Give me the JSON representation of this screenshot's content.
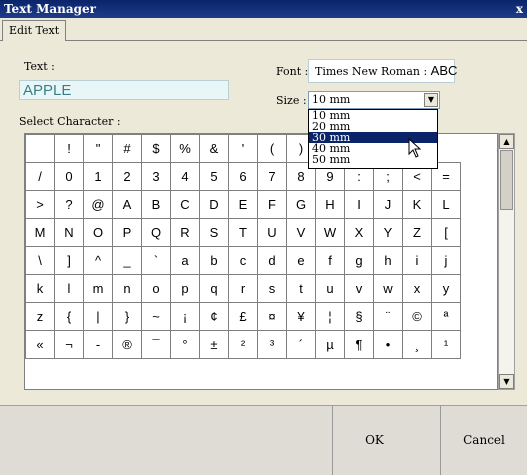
{
  "window": {
    "title": "Text Manager",
    "close_glyph": "x"
  },
  "tabs": [
    {
      "label": "Edit Text"
    }
  ],
  "text_section": {
    "label": "Text :",
    "value": "APPLE"
  },
  "font_section": {
    "label": "Font :",
    "value": "Times New Roman :",
    "preview": "ABC"
  },
  "size_section": {
    "label": "Size :",
    "selected": "10 mm",
    "options": [
      "10 mm",
      "20 mm",
      "30 mm",
      "40 mm",
      "50 mm"
    ],
    "highlighted": "30 mm"
  },
  "select_character": {
    "label": "Select Character :",
    "rows": [
      [
        "",
        "!",
        "\"",
        "#",
        "$",
        "%",
        "&",
        "'",
        "(",
        ")",
        "*",
        "+",
        "-",
        "."
      ],
      [
        "/",
        "0",
        "1",
        "2",
        "3",
        "4",
        "5",
        "6",
        "7",
        "8",
        "9",
        ":",
        ";",
        "<",
        "="
      ],
      [
        ">",
        "?",
        "@",
        "A",
        "B",
        "C",
        "D",
        "E",
        "F",
        "G",
        "H",
        "I",
        "J",
        "K",
        "L"
      ],
      [
        "M",
        "N",
        "O",
        "P",
        "Q",
        "R",
        "S",
        "T",
        "U",
        "V",
        "W",
        "X",
        "Y",
        "Z",
        "["
      ],
      [
        "\\",
        "]",
        "^",
        "_",
        "`",
        "a",
        "b",
        "c",
        "d",
        "e",
        "f",
        "g",
        "h",
        "i",
        "j"
      ],
      [
        "k",
        "l",
        "m",
        "n",
        "o",
        "p",
        "q",
        "r",
        "s",
        "t",
        "u",
        "v",
        "w",
        "x",
        "y"
      ],
      [
        "z",
        "{",
        "|",
        "}",
        "~",
        "¡",
        "¢",
        "£",
        "¤",
        "¥",
        "¦",
        "§",
        "¨",
        "©",
        "ª"
      ],
      [
        "«",
        "¬",
        "-",
        "®",
        "¯",
        "°",
        "±",
        "²",
        "³",
        "´",
        "µ",
        "¶",
        "•",
        "¸",
        "¹"
      ]
    ]
  },
  "footer": {
    "ok_label": "OK",
    "cancel_label": "Cancel"
  }
}
